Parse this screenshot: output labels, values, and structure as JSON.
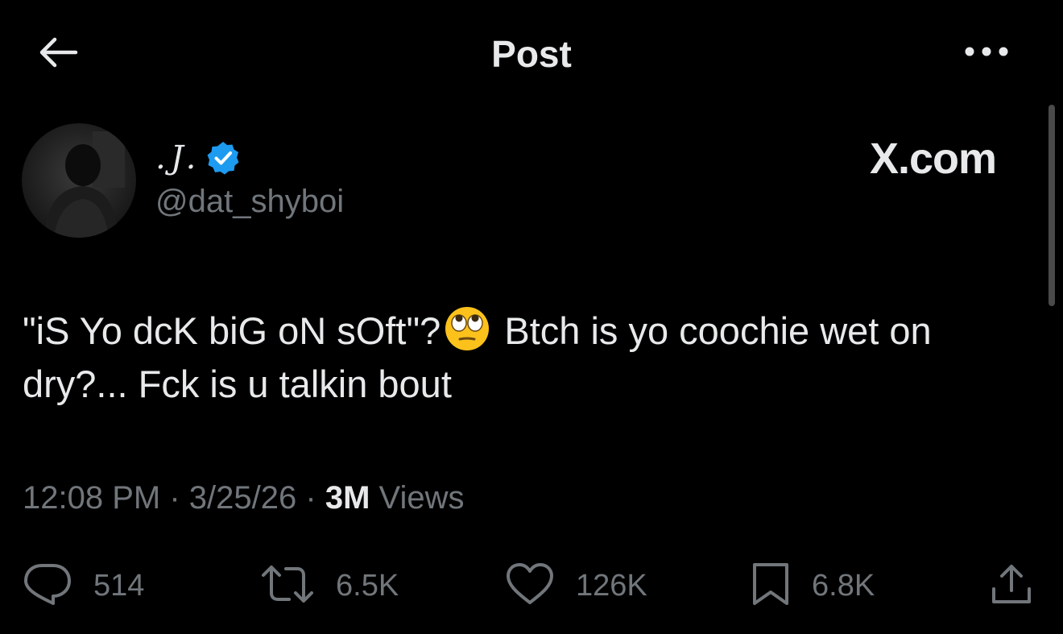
{
  "header": {
    "title": "Post",
    "back_icon": "arrow-left-icon",
    "more_icon": "more-horizontal-icon"
  },
  "author": {
    "display_name": ".J.",
    "handle": "@dat_shyboi",
    "verified": true,
    "verified_color": "#1d9bf0"
  },
  "brand": {
    "label": "X.com"
  },
  "post": {
    "text_part1": "\"iS Yo dcK biG oN sOft\"?",
    "emoji": "face-with-rolling-eyes",
    "text_part2": "Btch is yo coochie wet on dry?... Fck is u talkin bout"
  },
  "meta": {
    "time": "12:08 PM",
    "separator": "·",
    "date": "3/25/26",
    "views_count": "3M",
    "views_label": "Views"
  },
  "actions": {
    "replies": "514",
    "reposts": "6.5K",
    "likes": "126K",
    "bookmarks": "6.8K"
  },
  "colors": {
    "background": "#000000",
    "text_primary": "#e7e9ea",
    "text_secondary": "#71767b",
    "accent": "#1d9bf0"
  }
}
